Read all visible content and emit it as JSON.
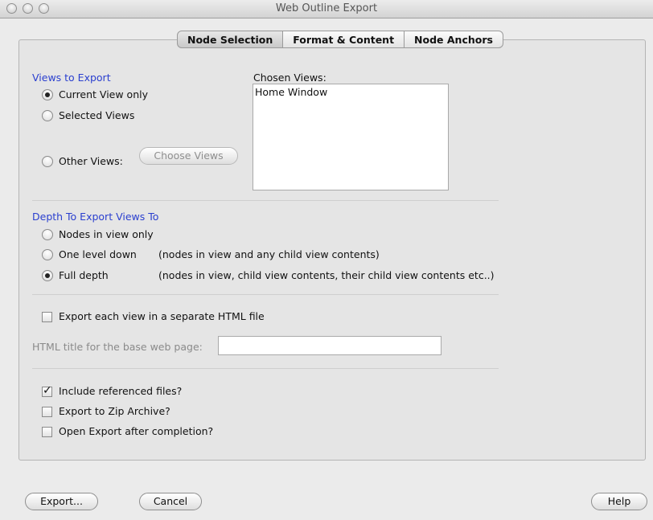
{
  "window": {
    "title": "Web Outline Export"
  },
  "tabs": [
    {
      "label": "Node Selection",
      "selected": true
    },
    {
      "label": "Format & Content",
      "selected": false
    },
    {
      "label": "Node Anchors",
      "selected": false
    }
  ],
  "views_section": {
    "heading": "Views to Export",
    "options": [
      {
        "label": "Current View only",
        "checked": true
      },
      {
        "label": "Selected Views",
        "checked": false
      },
      {
        "label": "Other Views:",
        "checked": false
      }
    ],
    "choose_button": "Choose Views",
    "chosen_label": "Chosen Views:",
    "chosen_items": [
      "Home Window"
    ]
  },
  "depth_section": {
    "heading": "Depth To Export Views To",
    "options": [
      {
        "label": "Nodes in view only",
        "note": "",
        "checked": false
      },
      {
        "label": "One level down",
        "note": "(nodes in view and any child view contents)",
        "checked": false
      },
      {
        "label": "Full depth",
        "note": "(nodes in view, child view contents, their child view contents etc..)",
        "checked": true
      }
    ]
  },
  "separate_file": {
    "label": "Export each view in a separate HTML file",
    "checked": false
  },
  "html_title": {
    "label": "HTML title for the base web page:",
    "value": ""
  },
  "options": [
    {
      "label": "Include referenced files?",
      "checked": true
    },
    {
      "label": "Export to Zip Archive?",
      "checked": false
    },
    {
      "label": "Open Export after completion?",
      "checked": false
    }
  ],
  "buttons": {
    "export": "Export...",
    "cancel": "Cancel",
    "help": "Help"
  }
}
